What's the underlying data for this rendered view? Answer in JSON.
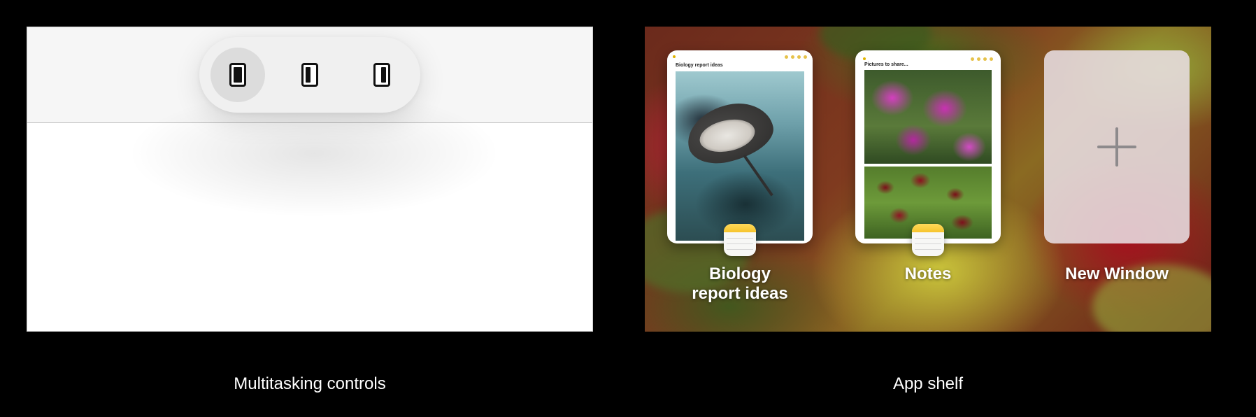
{
  "multitasking_panel": {
    "caption": "Multitasking controls",
    "options": [
      {
        "name": "full-screen-icon",
        "selected": true
      },
      {
        "name": "split-view-icon",
        "selected": false
      },
      {
        "name": "slide-over-icon",
        "selected": false
      }
    ]
  },
  "app_shelf_panel": {
    "caption": "App shelf",
    "windows": [
      {
        "label": "Biology\nreport ideas",
        "note_title": "Biology report ideas",
        "app_icon": "notes-app-icon"
      },
      {
        "label": "Notes",
        "note_title": "Pictures to share...",
        "app_icon": "notes-app-icon"
      }
    ],
    "new_window_label": "New Window"
  },
  "colors": {
    "background": "#000000",
    "notes_accent": "#F6C42C",
    "selected_option": "#DCDCDC"
  }
}
